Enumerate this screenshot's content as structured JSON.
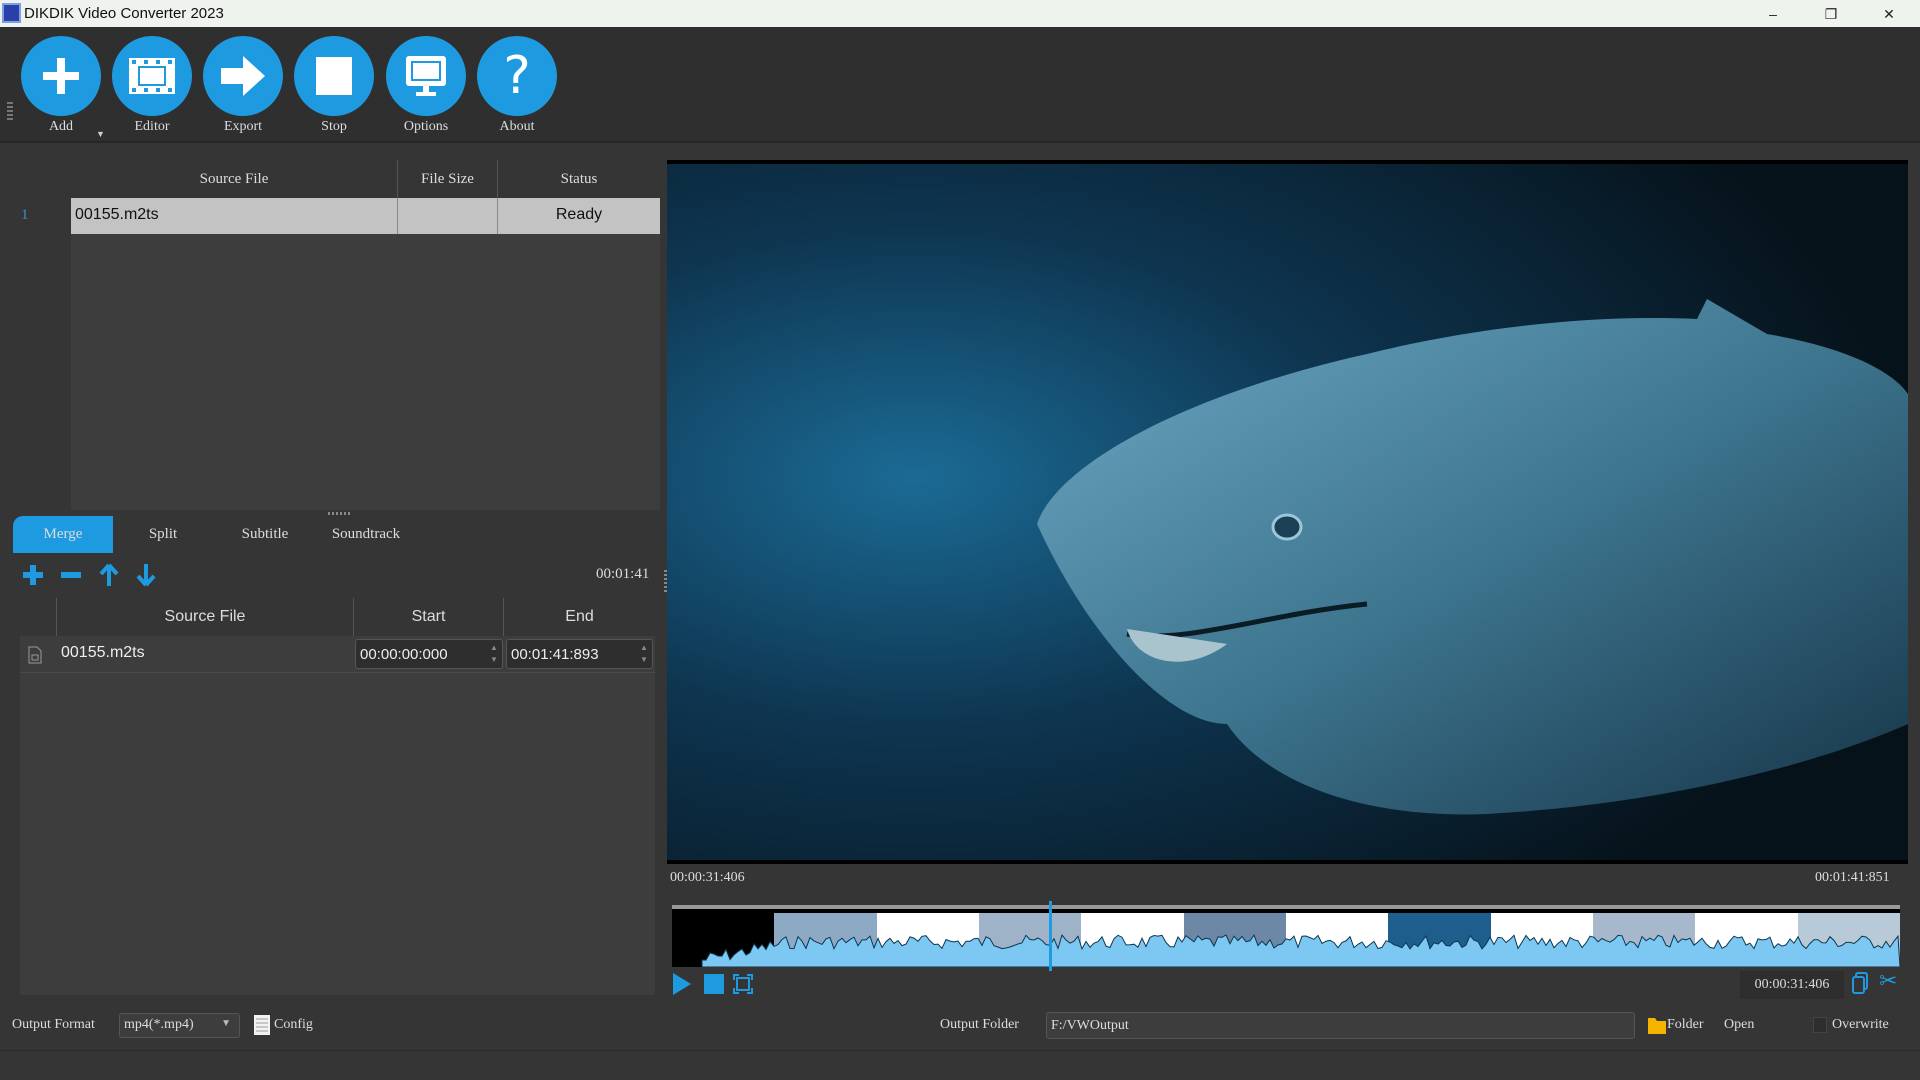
{
  "window": {
    "title": "DIKDIK Video Converter 2023",
    "minimize": "–",
    "restore": "❐",
    "close": "✕"
  },
  "toolbar": [
    {
      "label": "Add",
      "icon": "plus-icon"
    },
    {
      "label": "Editor",
      "icon": "film-icon"
    },
    {
      "label": "Export",
      "icon": "arrow-right-icon"
    },
    {
      "label": "Stop",
      "icon": "stop-icon"
    },
    {
      "label": "Options",
      "icon": "monitor-icon"
    },
    {
      "label": "About",
      "icon": "question-icon"
    }
  ],
  "file_list": {
    "columns": [
      "Source File",
      "File Size",
      "Status"
    ],
    "rows": [
      {
        "index": "1",
        "source": "00155.m2ts",
        "size": "",
        "status": "Ready"
      }
    ]
  },
  "tabs": [
    "Merge",
    "Split",
    "Subtitle",
    "Soundtrack"
  ],
  "active_tab": "Merge",
  "merge": {
    "duration": "00:01:41",
    "columns": [
      "Source File",
      "Start",
      "End"
    ],
    "rows": [
      {
        "source": "00155.m2ts",
        "start": "00:00:00:000",
        "end": "00:01:41:893"
      }
    ]
  },
  "player": {
    "time_start": "00:00:31:406",
    "time_end": "00:01:41:851",
    "current_time": "00:00:31:406",
    "playhead_fraction": 0.307
  },
  "bottom": {
    "output_format_label": "Output Format",
    "output_format": "mp4(*.mp4)",
    "config_label": "Config",
    "output_folder_label": "Output Folder",
    "output_folder": "F:/VWOutput",
    "folder_label": "Folder",
    "open_label": "Open",
    "overwrite_label": "Overwrite",
    "overwrite_checked": false
  },
  "colors": {
    "accent": "#1e9be0",
    "background": "#353535"
  }
}
